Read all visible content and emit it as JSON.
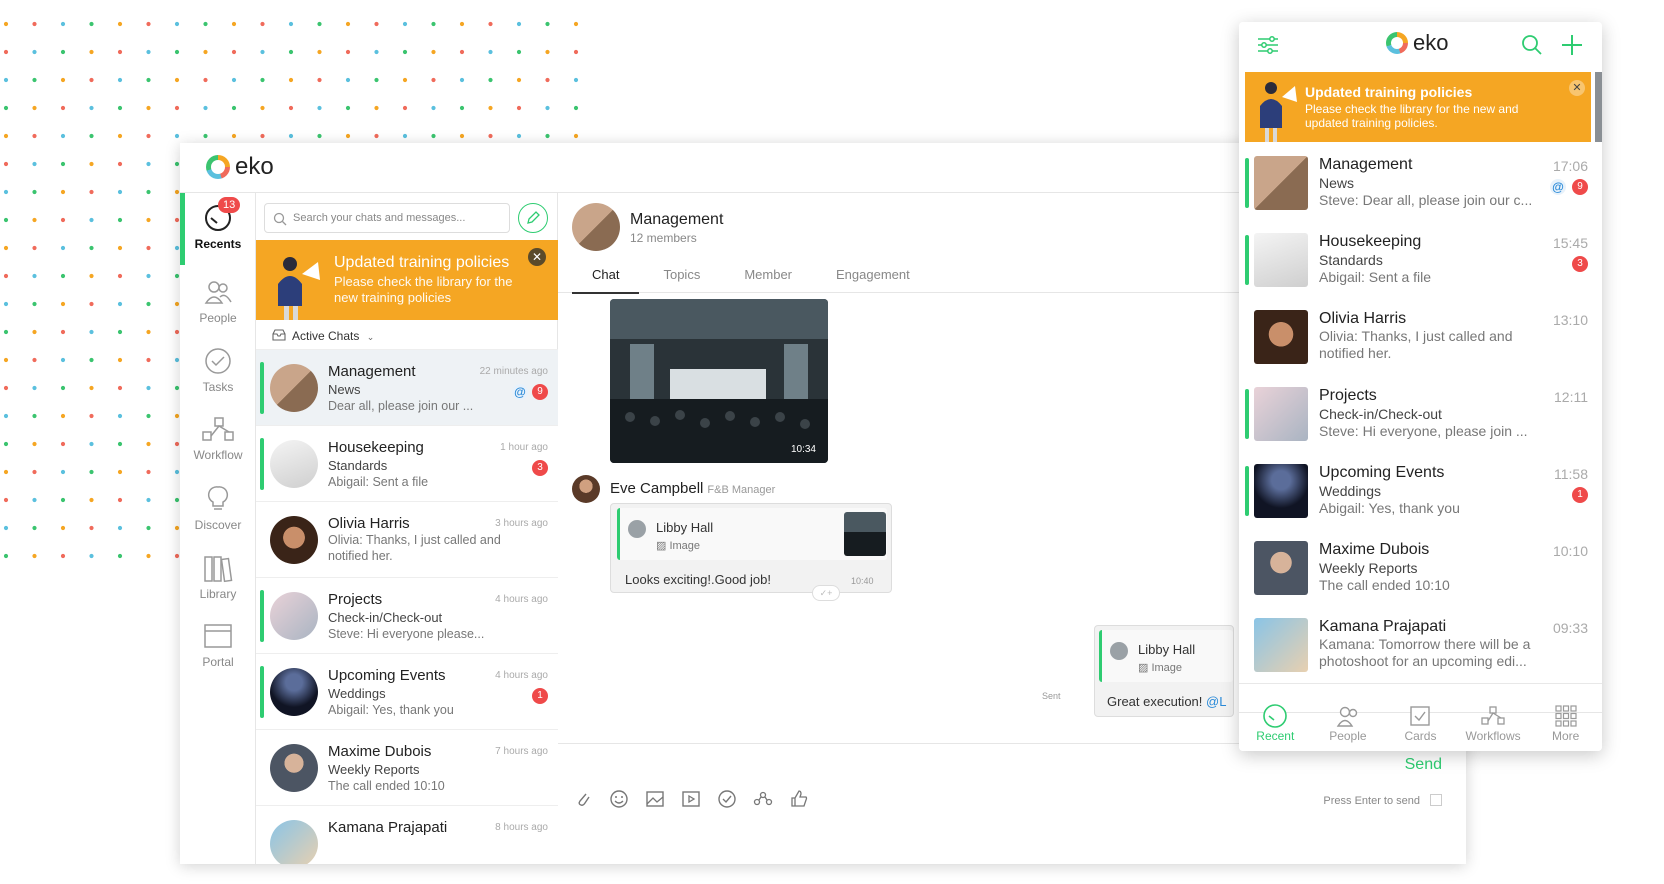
{
  "colors": {
    "accent": "#2ecc71",
    "banner": "#f5a623",
    "badge": "#ef4a4a",
    "mention": "#2a8ad8"
  },
  "brand": {
    "name": "eko"
  },
  "desktop": {
    "rail": [
      {
        "label": "Recents",
        "icon": "recents-icon",
        "badge": "13",
        "active": true
      },
      {
        "label": "People",
        "icon": "people-icon"
      },
      {
        "label": "Tasks",
        "icon": "tasks-icon"
      },
      {
        "label": "Workflow",
        "icon": "workflow-icon"
      },
      {
        "label": "Discover",
        "icon": "lightbulb-icon"
      },
      {
        "label": "Library",
        "icon": "library-icon"
      },
      {
        "label": "Portal",
        "icon": "portal-icon"
      }
    ],
    "search_placeholder": "Search your chats and messages...",
    "banner": {
      "title": "Updated training policies",
      "body": "Please check the library for the new training policies"
    },
    "filter_label": "Active Chats",
    "chats": [
      {
        "name": "Management",
        "sub": "News",
        "preview": "Dear all, please join our ...",
        "time": "22 minutes ago",
        "mention": "@",
        "badge": "9"
      },
      {
        "name": "Housekeeping",
        "sub": "Standards",
        "preview": "Abigail: Sent a file",
        "time": "1 hour ago",
        "badge": "3"
      },
      {
        "name": "Olivia Harris",
        "sub": "",
        "preview": "Olivia: Thanks, I just called and notified her.",
        "time": "3 hours ago"
      },
      {
        "name": "Projects",
        "sub": "Check-in/Check-out",
        "preview": "Steve: Hi everyone please...",
        "time": "4 hours ago"
      },
      {
        "name": "Upcoming Events",
        "sub": "Weddings",
        "preview": "Abigail: Yes, thank you",
        "time": "4 hours ago",
        "badge": "1"
      },
      {
        "name": "Maxime Dubois",
        "sub": "Weekly Reports",
        "preview": "The call ended 10:10",
        "time": "7 hours ago"
      },
      {
        "name": "Kamana Prajapati",
        "sub": "",
        "preview": "",
        "time": "8 hours ago"
      }
    ],
    "conversation": {
      "title": "Management",
      "members": "12 members",
      "tabs": [
        "Chat",
        "Topics",
        "Member",
        "Engagement"
      ],
      "image_time": "10:34",
      "sender": "Eve Campbell",
      "sender_role": "F&B Manager",
      "reply1": {
        "quote_name": "Libby Hall",
        "quote_type": "Image",
        "text": "Looks exciting!.Good job!",
        "time": "10:40"
      },
      "reply2": {
        "quote_name": "Libby Hall",
        "quote_type": "Image",
        "text": "Great execution!",
        "mention": "@L",
        "status": "Sent"
      },
      "send_label": "Send",
      "enter_label": "Press Enter to send"
    }
  },
  "mobile": {
    "banner": {
      "title": "Updated training policies",
      "body": "Please check the library for the new and updated training policies."
    },
    "chats": [
      {
        "name": "Management",
        "sub": "News",
        "preview": "Steve: Dear all, please join our c...",
        "time": "17:06",
        "mention": "@",
        "badge": "9"
      },
      {
        "name": "Housekeeping",
        "sub": "Standards",
        "preview": "Abigail: Sent a file",
        "time": "15:45",
        "badge": "3"
      },
      {
        "name": "Olivia Harris",
        "sub": "",
        "preview": "Olivia: Thanks, I just called and notified her.",
        "time": "13:10"
      },
      {
        "name": "Projects",
        "sub": "Check-in/Check-out",
        "preview": "Steve: Hi everyone, please join ...",
        "time": "12:11"
      },
      {
        "name": "Upcoming Events",
        "sub": "Weddings",
        "preview": "Abigail: Yes, thank you",
        "time": "11:58",
        "badge": "1"
      },
      {
        "name": "Maxime Dubois",
        "sub": "Weekly Reports",
        "preview": "The call ended 10:10",
        "time": "10:10"
      },
      {
        "name": "Kamana Prajapati",
        "sub": "",
        "preview": "Kamana: Tomorrow there will be a photoshoot for an upcoming edi...",
        "time": "09:33"
      }
    ],
    "nav": [
      {
        "label": "Recent",
        "icon": "recent-icon",
        "active": true
      },
      {
        "label": "People",
        "icon": "people-icon"
      },
      {
        "label": "Cards",
        "icon": "cards-icon"
      },
      {
        "label": "Workflows",
        "icon": "workflows-icon"
      },
      {
        "label": "More",
        "icon": "grid-icon"
      }
    ]
  }
}
